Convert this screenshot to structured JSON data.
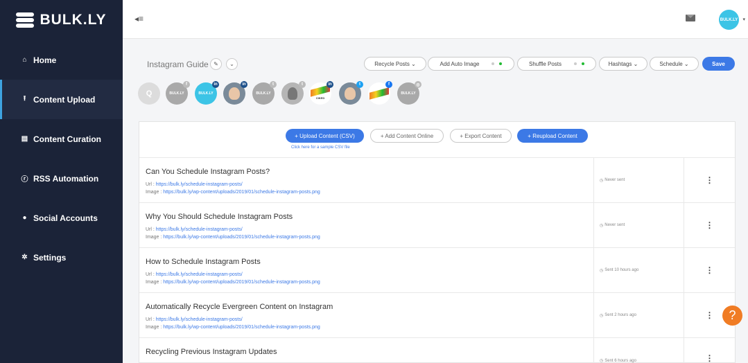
{
  "brand": {
    "name": "BULK.LY"
  },
  "sidebar": {
    "items": [
      {
        "label": "Home",
        "icon": "home-icon",
        "glyph": "⌂"
      },
      {
        "label": "Content Upload",
        "icon": "upload-icon",
        "glyph": "⭱"
      },
      {
        "label": "Content Curation",
        "icon": "document-icon",
        "glyph": "▤"
      },
      {
        "label": "RSS Automation",
        "icon": "rss-icon",
        "glyph": "ⓡ"
      },
      {
        "label": "Social Accounts",
        "icon": "user-icon",
        "glyph": "●"
      },
      {
        "label": "Settings",
        "icon": "gear-icon",
        "glyph": "✲"
      }
    ],
    "active_index": 1
  },
  "topbar": {
    "collapse_glyph": "◂≡",
    "avatar_text": "BULK.LY",
    "caret": "▾"
  },
  "toolbar": {
    "title": "Instagram Guide",
    "edit_glyph": "✎",
    "dropdown_glyph": "⌄",
    "recycle_label": "Recycle Posts ⌄",
    "auto_image_label": "Add Auto Image",
    "shuffle_label": "Shuffle Posts",
    "hashtags_label": "Hashtags ⌄",
    "schedule_label": "Schedule ⌄",
    "save_label": "Save"
  },
  "accounts": {
    "search_glyph": "Q",
    "logo_text": "BULK.LY",
    "ciked_text": "CIKED"
  },
  "actions": {
    "upload_csv": "+ Upload Content (CSV)",
    "add_online": "+ Add Content Online",
    "export": "+ Export Content",
    "reupload": "+ Reupload Content",
    "csv_link": "Click here for a sample CSV file"
  },
  "posts": [
    {
      "title": "Can You Schedule Instagram Posts?",
      "url_label": "Url : ",
      "url": "https://bulk.ly/schedule-instagram-posts/",
      "image_label": "Image : ",
      "image": "https://bulk.ly/wp-content/uploads/2019/01/schedule-instagram-posts.png",
      "status": "Never sent"
    },
    {
      "title": "Why You Should Schedule Instagram Posts",
      "url_label": "Url : ",
      "url": "https://bulk.ly/schedule-instagram-posts/",
      "image_label": "Image : ",
      "image": "https://bulk.ly/wp-content/uploads/2019/01/schedule-instagram-posts.png",
      "status": "Never sent"
    },
    {
      "title": "How to Schedule Instagram Posts",
      "url_label": "Url : ",
      "url": "https://bulk.ly/schedule-instagram-posts/",
      "image_label": "Image : ",
      "image": "https://bulk.ly/wp-content/uploads/2019/01/schedule-instagram-posts.png",
      "status": "Sent 10 hours ago"
    },
    {
      "title": "Automatically Recycle Evergreen Content on Instagram",
      "url_label": "Url : ",
      "url": "https://bulk.ly/schedule-instagram-posts/",
      "image_label": "Image : ",
      "image": "https://bulk.ly/wp-content/uploads/2019/01/schedule-instagram-posts.png",
      "status": "Sent 2 hours ago"
    },
    {
      "title": "Recycling Previous Instagram Updates",
      "url_label": "",
      "url": "",
      "image_label": "",
      "image": "",
      "status": "Sent 6 hours ago"
    }
  ],
  "status_glyph": "◷",
  "menu_glyph": "⋮",
  "help_glyph": "?",
  "colors": {
    "sidebar": "#1b2338",
    "accent": "#3c79e6",
    "active_dot": "#22bb33",
    "help": "#f07c24"
  }
}
